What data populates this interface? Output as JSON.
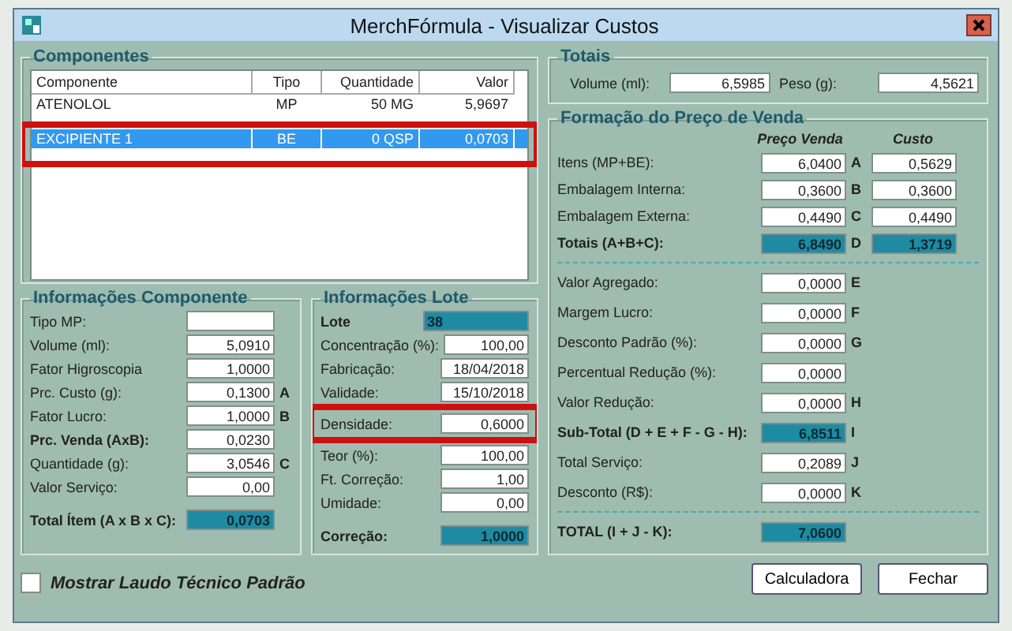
{
  "window": {
    "title": "MerchFórmula - Visualizar Custos"
  },
  "components": {
    "title": "Componentes",
    "columns": [
      "Componente",
      "Tipo",
      "Quantidade",
      "Valor"
    ],
    "rows": [
      {
        "cells": [
          "ATENOLOL",
          "MP",
          "50 MG",
          "5,9697"
        ],
        "selected": false
      },
      {
        "cells": [
          "EXCIPIENTE 1",
          "BE",
          "0 QSP",
          "0,0703"
        ],
        "selected": true
      }
    ]
  },
  "componente_info": {
    "title": "Informações Componente",
    "fields": [
      {
        "label": "Tipo MP:",
        "kind": "input",
        "bold": false
      },
      {
        "label": "Volume (ml):",
        "value": "5,0910",
        "kind": "input",
        "bold": false
      },
      {
        "label": "Fator Higroscopia",
        "value": "1,0000",
        "kind": "input",
        "bold": false
      },
      {
        "label": "Prc. Custo (g):",
        "value": "0,1300",
        "letter": "A",
        "kind": "input",
        "bold": false
      },
      {
        "label": "Fator Lucro:",
        "value": "1,0000",
        "letter": "B",
        "kind": "input",
        "bold": false
      },
      {
        "label": "Prc. Venda (AxB):",
        "value": "0,0230",
        "kind": "input",
        "bold": true
      },
      {
        "label": "Quantidade (g):",
        "value": "3,0546",
        "letter": "C",
        "kind": "input",
        "bold": false
      },
      {
        "label": "Valor Serviço:",
        "value": "0,00",
        "kind": "input",
        "bold": false
      },
      {
        "label": "Total Ítem (A x B x C):",
        "value": "0,0703",
        "kind": "total",
        "bold": true
      }
    ]
  },
  "lote_info": {
    "title": "Informações Lote",
    "lote": {
      "label": "Lote",
      "value": "38"
    },
    "fields": [
      {
        "label": "Concentração (%):",
        "value": "100,00",
        "kind": "input",
        "bold": false
      },
      {
        "label": "Fabricação:",
        "value": "18/04/2018",
        "kind": "input",
        "bold": false
      },
      {
        "label": "Validade:",
        "value": "15/10/2018",
        "kind": "input",
        "bold": false
      },
      {
        "label": "Densidade:",
        "value": "0,6000",
        "kind": "input",
        "bold": false
      },
      {
        "label": "Teor (%):",
        "value": "100,00",
        "kind": "input",
        "bold": false
      },
      {
        "label": "Ft. Correção:",
        "value": "1,00",
        "kind": "input",
        "bold": false
      },
      {
        "label": "Umidade:",
        "value": "0,00",
        "kind": "input",
        "bold": false
      },
      {
        "label": "Correção:",
        "value": "1,0000",
        "kind": "total",
        "bold": true
      }
    ]
  },
  "totais": {
    "title": "Totais",
    "fields": [
      {
        "label": "Volume (ml):",
        "value": "6,5985"
      },
      {
        "label": "Peso (g):",
        "value": "4,5621"
      }
    ]
  },
  "formacao": {
    "title": "Formação do Preço de Venda",
    "headers": [
      "Preço Venda",
      "Custo"
    ],
    "sections": [
      [
        {
          "label": "Itens (MP+BE):",
          "kind": "input",
          "bold": false,
          "venda": "6,0400",
          "letter": "A",
          "custo": "0,5629"
        },
        {
          "label": "Embalagem Interna:",
          "kind": "input",
          "bold": false,
          "venda": "0,3600",
          "letter": "B",
          "custo": "0,3600"
        },
        {
          "label": "Embalagem Externa:",
          "kind": "input",
          "bold": false,
          "venda": "0,4490",
          "letter": "C",
          "custo": "0,4490"
        },
        {
          "label": "Totais (A+B+C):",
          "kind": "total",
          "bold": true,
          "venda": "6,8490",
          "letter": "D",
          "custo": "1,3719"
        }
      ],
      [
        {
          "label": "Valor Agregado:",
          "kind": "input",
          "bold": false,
          "venda": "0,0000",
          "letter": "E"
        },
        {
          "label": "Margem Lucro:",
          "kind": "input",
          "bold": false,
          "venda": "0,0000",
          "letter": "F"
        },
        {
          "label": "Desconto Padrão (%):",
          "kind": "input",
          "bold": false,
          "venda": "0,0000",
          "letter": "G"
        },
        {
          "label": "Percentual Redução (%):",
          "kind": "input",
          "bold": false,
          "venda": "0,0000"
        },
        {
          "label": "Valor Redução:",
          "kind": "input",
          "bold": false,
          "venda": "0,0000",
          "letter": "H"
        },
        {
          "label": "Sub-Total (D + E + F - G - H):",
          "kind": "total",
          "bold": true,
          "venda": "6,8511",
          "letter": "I"
        },
        {
          "label": "Total Serviço:",
          "kind": "input",
          "bold": false,
          "venda": "0,2089",
          "letter": "J"
        },
        {
          "label": "Desconto (R$):",
          "kind": "input",
          "bold": false,
          "venda": "0,0000",
          "letter": "K"
        }
      ],
      [
        {
          "label": "TOTAL (I + J - K):",
          "kind": "total",
          "bold": true,
          "venda": "7,0600"
        }
      ]
    ]
  },
  "checkbox": {
    "label": "Mostrar Laudo Técnico Padrão",
    "checked": false
  },
  "buttons": [
    "Calculadora",
    "Fechar"
  ]
}
